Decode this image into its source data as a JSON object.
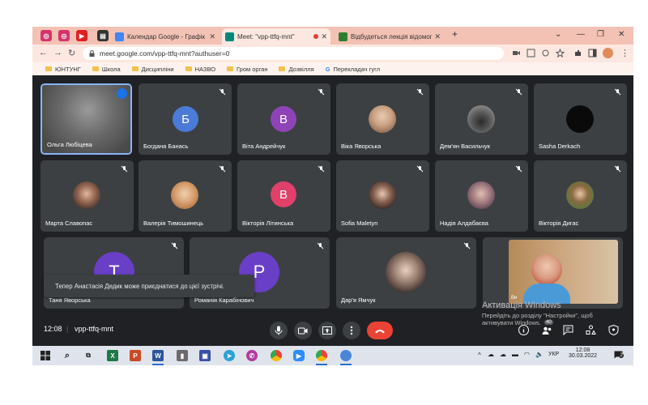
{
  "browser": {
    "tabs": [
      {
        "title": "Календар Google - Графік почи",
        "color": "#4285f4"
      },
      {
        "title": "Meet: \"vpp-ttfq-mnt\"",
        "color": "#00897b"
      },
      {
        "title": "Відбудеться лекція відомого на",
        "color": "#2e7d32"
      }
    ],
    "url": "meet.google.com/vpp-ttfq-mnt?authuser=0",
    "bookmarks": [
      "ЮНТУНГ",
      "Школа",
      "Дисципліни",
      "НАЗВО",
      "Гром орган",
      "Дозвілля",
      "Перекладач гугл"
    ]
  },
  "meet": {
    "participants": [
      {
        "name": "Ольга Любіцева",
        "kind": "video",
        "initial": ""
      },
      {
        "name": "Богдана Банась",
        "kind": "letter",
        "initial": "Б",
        "color": "#4a7bd6"
      },
      {
        "name": "Віта Андрейчук",
        "kind": "letter",
        "initial": "В",
        "color": "#8e44b6"
      },
      {
        "name": "Віка Яворська",
        "kind": "photo",
        "initial": ""
      },
      {
        "name": "Дем'ян Васильчук",
        "kind": "photo",
        "initial": ""
      },
      {
        "name": "Sasha Derkach",
        "kind": "photo",
        "initial": ""
      },
      {
        "name": "Марта Славопас",
        "kind": "photo",
        "initial": ""
      },
      {
        "name": "Валерія Тимошинець",
        "kind": "photo",
        "initial": ""
      },
      {
        "name": "Вікторія Літинська",
        "kind": "letter",
        "initial": "В",
        "color": "#e0406a"
      },
      {
        "name": "Sofia Maletyn",
        "kind": "photo",
        "initial": ""
      },
      {
        "name": "Надія Алдабаєва",
        "kind": "photo",
        "initial": ""
      },
      {
        "name": "Вікторія Дигас",
        "kind": "photo",
        "initial": ""
      },
      {
        "name": "Таня Яворська",
        "kind": "letter",
        "initial": "Т",
        "color": "#6a3fc7"
      },
      {
        "name": "Романія Карабінович",
        "kind": "letter",
        "initial": "Р",
        "color": "#6a3fc7"
      },
      {
        "name": "Дар'я Ямчук",
        "kind": "photo",
        "initial": ""
      },
      {
        "name": "",
        "kind": "video",
        "initial": ""
      }
    ],
    "toast": "Тепер Анастасія Дедик може приєднатися до цієї зустрічі.",
    "time": "12:08",
    "meeting_code": "vpp-ttfq-mnt",
    "tile_label_small": "Ви",
    "people_count": "40",
    "activation_title": "Активація Windows",
    "activation_line1": "Перейдіть до розділу \"Настройки\", щоб",
    "activation_line2": "активувати Windows."
  },
  "taskbar": {
    "lang": "УКР",
    "time": "12:08",
    "date": "30.03.2022",
    "notif_count": "2"
  },
  "colors": {
    "meet_bg": "#202124",
    "tile_bg": "#3c4043",
    "end_call": "#ea4335",
    "active_border": "#8ab4f8"
  }
}
